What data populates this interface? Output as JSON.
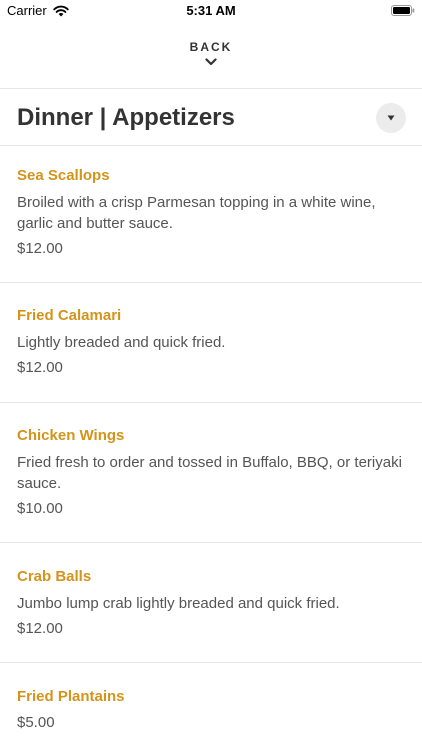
{
  "status_bar": {
    "carrier": "Carrier",
    "time": "5:31 AM",
    "wifi_icon": "wifi-icon",
    "battery_icon": "battery-icon"
  },
  "nav": {
    "back_label": "BACK",
    "back_icon": "chevron-down-icon"
  },
  "header": {
    "title": "Dinner | Appetizers",
    "dropdown_icon": "caret-down-icon"
  },
  "colors": {
    "accent": "#d4941c",
    "text": "#333333",
    "body_text": "#555555",
    "divider": "#e6e6e6"
  },
  "items": [
    {
      "name": "Sea Scallops",
      "description": "Broiled with a crisp Parmesan topping in a white wine, garlic and butter sauce.",
      "price": "$12.00"
    },
    {
      "name": "Fried Calamari",
      "description": "Lightly breaded and quick fried.",
      "price": "$12.00"
    },
    {
      "name": "Chicken Wings",
      "description": "Fried fresh to order and tossed in Buffalo, BBQ, or teriyaki sauce.",
      "price": "$10.00"
    },
    {
      "name": "Crab Balls",
      "description": "Jumbo lump crab lightly breaded and quick fried.",
      "price": "$12.00"
    },
    {
      "name": "Fried Plantains",
      "description": "",
      "price": "$5.00"
    }
  ]
}
